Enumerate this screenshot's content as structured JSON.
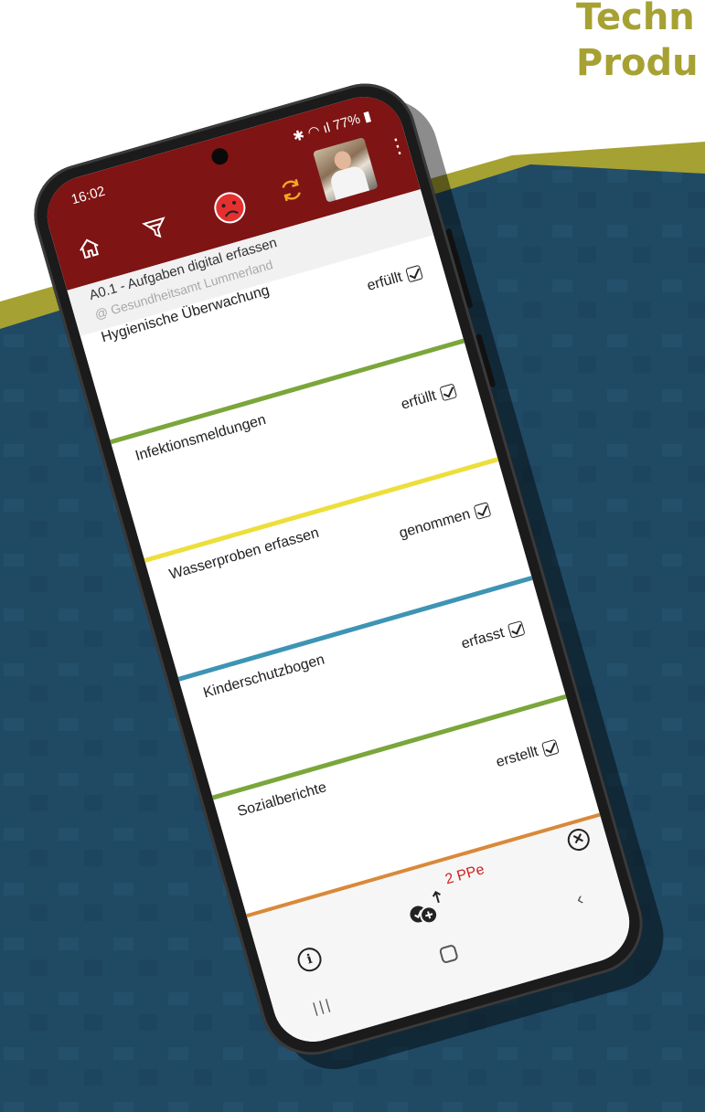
{
  "background": {
    "headline": "Techn\nProdu",
    "accent_color": "#a6a133",
    "panel_color": "#204a66"
  },
  "status_bar": {
    "time": "16:02",
    "battery": "77%"
  },
  "app_bar": {
    "color": "#7e1413",
    "icons": [
      "home-icon",
      "filter-icon",
      "sad-face-icon",
      "sync-icon",
      "avatar",
      "more-vert-icon"
    ]
  },
  "header": {
    "subtitle": "A0.1 - Aufgaben digital erfassen",
    "organization": "@ Gesundheitsamt Lummerland"
  },
  "tasks": [
    {
      "title": "Hygienische Überwachung",
      "status": "erfüllt",
      "color": "#7aa63b"
    },
    {
      "title": "Infektionsmeldungen",
      "status": "erfüllt",
      "color": "#ecdf3c"
    },
    {
      "title": "Wasserproben erfassen",
      "status": "genommen",
      "color": "#3e94b4"
    },
    {
      "title": "Kinderschutzbogen",
      "status": "erfasst",
      "color": "#7aa63b"
    },
    {
      "title": "Sozialberichte",
      "status": "erstellt",
      "color": "#d9893a"
    }
  ],
  "bottom_bar": {
    "ppe_label": "2 PPe"
  }
}
